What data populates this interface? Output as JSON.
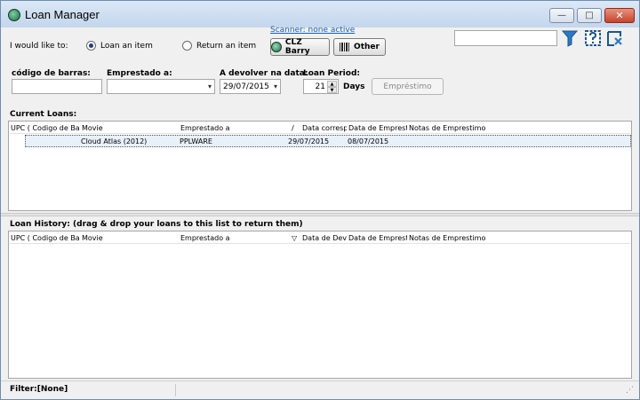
{
  "window": {
    "title": "Loan Manager",
    "minimize_glyph": "—",
    "maximize_glyph": "□",
    "close_glyph": "✕"
  },
  "colors": {
    "accent": "#1a5fb4",
    "title_bg": "#c3d6ec",
    "close_red": "#c8432b"
  },
  "actions": {
    "prompt": "I would like to:",
    "options": [
      {
        "label": "Loan an item",
        "selected": true
      },
      {
        "label": "Return an item",
        "selected": false
      }
    ]
  },
  "scanner": {
    "status_link": "Scanner: none active",
    "clz_button": "CLZ Barry",
    "other_button": "Other"
  },
  "search": {
    "value": "",
    "icons": [
      "filter-icon",
      "help-icon",
      "clear-filter-icon"
    ]
  },
  "form": {
    "barcode_label": "código de barras:",
    "barcode_value": "",
    "loaned_to_label": "Emprestado a:",
    "loaned_to_value": "",
    "due_label": "A devolver na data:",
    "due_value": "29/07/2015",
    "period_label": "Loan Period:",
    "period_value": "21",
    "period_unit": "Days",
    "loan_button": "Empréstimo"
  },
  "current_loans": {
    "title": "Current Loans:",
    "columns": [
      "UPC ( Codigo de Barras )",
      "Movie",
      "Emprestado a",
      "/",
      "Data correspondente",
      "Data de Emprestimo",
      "Notas de Emprestimo"
    ],
    "rows": [
      {
        "upc": "",
        "movie": "Cloud Atlas (2012)",
        "loaned_to": "PPLWARE",
        "due": "29/07/2015",
        "loan_date": "08/07/2015",
        "notes": ""
      }
    ]
  },
  "loan_history": {
    "title": "Loan History: (drag & drop your loans to this list to return them)",
    "columns": [
      "UPC ( Codigo de Barras )",
      "Movie",
      "Emprestado a",
      "▽",
      "Data de Devolução",
      "Data de Emprestimo",
      "Notas de Emprestimo"
    ]
  },
  "status": {
    "filter": "Filter:[None]",
    "grip": "⋰"
  }
}
